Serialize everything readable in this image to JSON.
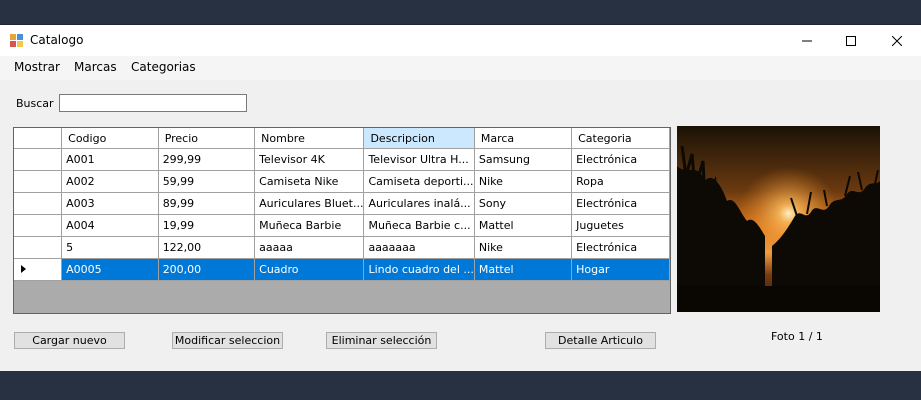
{
  "window": {
    "title": "Catalogo",
    "icon": "app-icon",
    "controls": {
      "minimize": "minimize-icon",
      "maximize": "maximize-icon",
      "close": "close-icon"
    }
  },
  "menu": [
    "Mostrar",
    "Marcas",
    "Categorias"
  ],
  "search": {
    "label": "Buscar",
    "value": ""
  },
  "grid": {
    "columns": [
      "Codigo",
      "Precio",
      "Nombre",
      "Descripcion",
      "Marca",
      "Categoria"
    ],
    "sorted_column": "Descripcion",
    "rows": [
      [
        "A001",
        "299,99",
        "Televisor 4K",
        "Televisor Ultra H...",
        "Samsung",
        "Electrónica"
      ],
      [
        "A002",
        "59,99",
        "Camiseta Nike",
        "Camiseta deporti...",
        "Nike",
        "Ropa"
      ],
      [
        "A003",
        "89,99",
        "Auriculares Bluet...",
        "Auriculares inalá...",
        "Sony",
        "Electrónica"
      ],
      [
        "A004",
        "19,99",
        "Muñeca Barbie",
        "Muñeca Barbie c...",
        "Mattel",
        "Juguetes"
      ],
      [
        "5",
        "122,00",
        "aaaaa",
        "aaaaaaa",
        "Nike",
        "Electrónica"
      ],
      [
        "A0005",
        "200,00",
        "Cuadro",
        "Lindo cuadro del ...",
        "Mattel",
        "Hogar"
      ]
    ],
    "selected_row": 5,
    "selection_color": "#0078d7"
  },
  "buttons": {
    "cargar": "Cargar nuevo",
    "modificar": "Modificar seleccion",
    "eliminar": "Eliminar selección",
    "detalle": "Detalle Articulo"
  },
  "foto_counter": "Foto 1 / 1"
}
